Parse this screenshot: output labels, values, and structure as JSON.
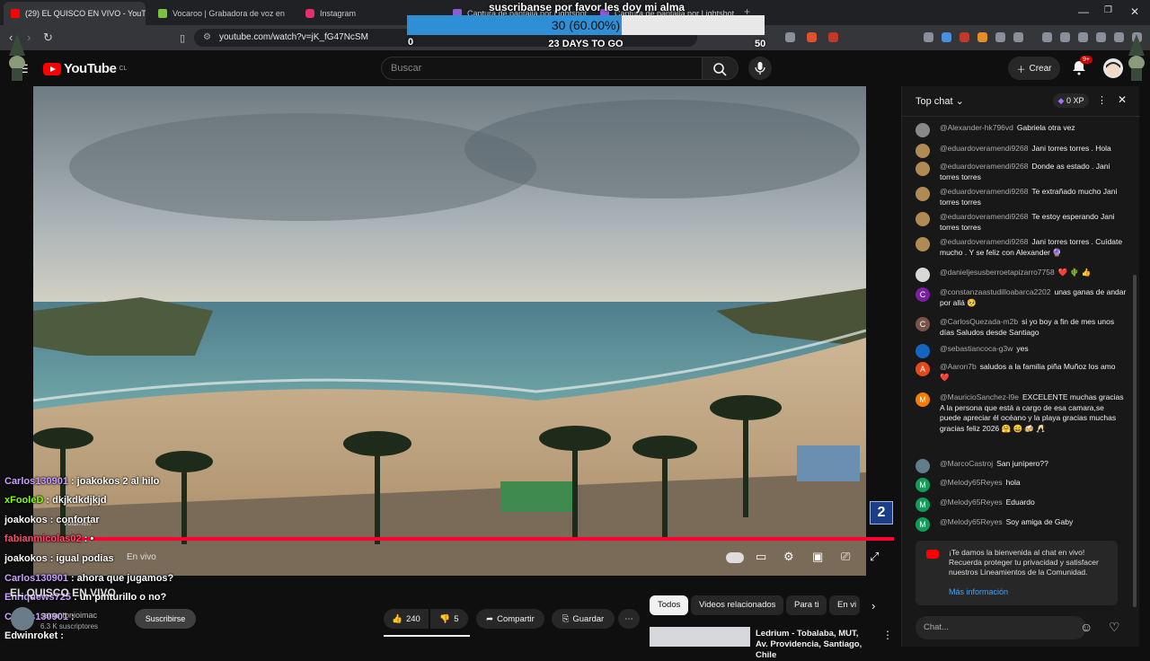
{
  "browser": {
    "tabs": [
      {
        "label": "(29) EL QUISCO EN VIVO - YouTu",
        "active": true,
        "favicon_color": "#ff0000"
      },
      {
        "label": "Vocaroo | Grabadora de voz en lí",
        "active": false,
        "favicon_color": "#7cc242"
      },
      {
        "label": "Instagram",
        "active": false,
        "favicon_color": "#e1306c"
      },
      {
        "label": "Captura de pantalla por Lightshot",
        "active": false,
        "favicon_color": "#8f5bd1"
      },
      {
        "label": "Captura de pantalla por Lightshot",
        "active": false,
        "favicon_color": "#8f5bd1"
      }
    ],
    "new_tab": "+",
    "url": "youtube.com/watch?v=jK_fG47NcSM",
    "window_controls": [
      "minimize-icon",
      "restore-icon",
      "close-icon"
    ]
  },
  "goal_overlay": {
    "title": "suscribanse por favor les doy mi alma",
    "value_label": "30 (60.00%)",
    "progress": 0.6,
    "min": "0",
    "max": "50",
    "days_left": "23 DAYS TO GO"
  },
  "youtube": {
    "logo_text": "YouTube",
    "logo_country": "CL",
    "search_placeholder": "Buscar",
    "create_label": "Crear",
    "notif_count": "9+"
  },
  "overlay_chat": [
    {
      "user": "Carlos130901",
      "text": ": joakokos 2 al hilo",
      "user_color": "#c9a0ff",
      "text_color": "#ffffff"
    },
    {
      "user": "xFooleD",
      "text": ": dkjkdkdjkjd",
      "user_color": "#7fff00",
      "text_color": "#ffffff"
    },
    {
      "user": "joakokos",
      "text": ": confortar",
      "user_color": "#ffffff",
      "text_color": "#ffffff"
    },
    {
      "user": "fabianmicolas02",
      "text": ": •",
      "user_color": "#ff4a6a",
      "text_color": "#ffffff"
    },
    {
      "user": "joakokos",
      "text": ": igual podias",
      "user_color": "#ffffff",
      "text_color": "#ffffff"
    },
    {
      "user": "Carlos130901",
      "text": ": ahora que jugamos?",
      "user_color": "#c9a0ff",
      "text_color": "#ffffff"
    },
    {
      "user": "Enriquews725",
      "text": ": un pinturillo o no?",
      "user_color": "#c9a0ff",
      "text_color": "#ffffff"
    },
    {
      "user": "Carlos130901",
      "text": ":",
      "user_color": "#c9a0ff",
      "text_color": "#ffffff"
    },
    {
      "user": "Edwinroket",
      "text": ":",
      "user_color": "#ffffff",
      "text_color": "#ffffff"
    }
  ],
  "video": {
    "live_label": "En vivo",
    "volume_label": "Volumen",
    "channel_badge": "2"
  },
  "channel": {
    "name": "EL QUISCO EN VIVO",
    "handle": "sanantonioimac",
    "subscribers": "6.3 K suscriptores",
    "subscribe_label": "Suscribirse"
  },
  "actions": {
    "likes": "240",
    "dislikes": "5",
    "share": "Compartir",
    "save": "Guardar"
  },
  "chips": [
    "Todos",
    "Videos relacionados",
    "Para ti",
    "En vi"
  ],
  "recommendation": {
    "title": "Ledrium - Tobalaba, MUT, Av. Providencia, Santiago, Chile"
  },
  "chat": {
    "title": "Top chat",
    "xp": "0 XP",
    "messages": [
      {
        "author": "@Alexander-hk796vd",
        "text": "Gabriela otra vez",
        "avatar": "",
        "avatar_color": "#888888"
      },
      {
        "author": "@eduardoveramendi9268",
        "text": "Jani torres torres . Hola",
        "avatar": "",
        "avatar_color": "#b08a55"
      },
      {
        "author": "@eduardoveramendi9268",
        "text": "Donde as estado . Jani torres torres",
        "avatar": "",
        "avatar_color": "#b08a55"
      },
      {
        "author": "@eduardoveramendi9268",
        "text": "Te extrañado mucho Jani torres torres",
        "avatar": "",
        "avatar_color": "#b08a55"
      },
      {
        "author": "@eduardoveramendi9268",
        "text": "Te estoy esperando Jani torres torres",
        "avatar": "",
        "avatar_color": "#b08a55"
      },
      {
        "author": "@eduardoveramendi9268",
        "text": "Jani torres torres . Cuídate mucho . Y se feliz con Alexander 🔮",
        "avatar": "",
        "avatar_color": "#b08a55"
      },
      {
        "author": "@danieljesusberroetapizarro7758",
        "text": "❤️ 🌵 👍",
        "avatar": "",
        "avatar_color": "#d8d8d8"
      },
      {
        "author": "@constanzaastudilloabarca2202",
        "text": "unas ganas de andar por allá 🥺",
        "avatar": "C",
        "avatar_color": "#7b1fa2"
      },
      {
        "author": "@CarlosQuezada-m2b",
        "text": "si yo boy a fin de mes unos días Saludos desde Santiago",
        "avatar": "C",
        "avatar_color": "#795548"
      },
      {
        "author": "@sebastiancoca-g3w",
        "text": "yes",
        "avatar": "",
        "avatar_color": "#1565c0"
      },
      {
        "author": "@Aaron7b",
        "text": "saludos a la familia piña Muñoz los amo ❤️",
        "avatar": "A",
        "avatar_color": "#e64a19"
      },
      {
        "author": "@MauricioSanchez-l9e",
        "text": "EXCELENTE muchas gracias A la persona que está a cargo de esa camara,se puede apreciar él océano y la playa gracias muchas gracias feliz 2026 🤗 😄 🍻 🥂",
        "avatar": "M",
        "avatar_color": "#f57c00"
      },
      {
        "author": "@MarcoCastroj",
        "text": "San junípero??",
        "avatar": "",
        "avatar_color": "#607d8b"
      },
      {
        "author": "@Melody65Reyes",
        "text": "hola",
        "avatar": "M",
        "avatar_color": "#0f9d58"
      },
      {
        "author": "@Melody65Reyes",
        "text": "Eduardo",
        "avatar": "M",
        "avatar_color": "#0f9d58"
      },
      {
        "author": "@Melody65Reyes",
        "text": "Soy amiga de Gaby",
        "avatar": "M",
        "avatar_color": "#0f9d58"
      }
    ],
    "welcome_text": "¡Te damos la bienvenida al chat en vivo! Recuerda proteger tu privacidad y satisfacer nuestros Lineamientos de la Comunidad.",
    "welcome_link": "Más información",
    "input_placeholder": "Chat..."
  },
  "colors": {
    "accent": "#ff0033",
    "goal_fill": "#2e8fd6",
    "link": "#3ea6ff"
  }
}
